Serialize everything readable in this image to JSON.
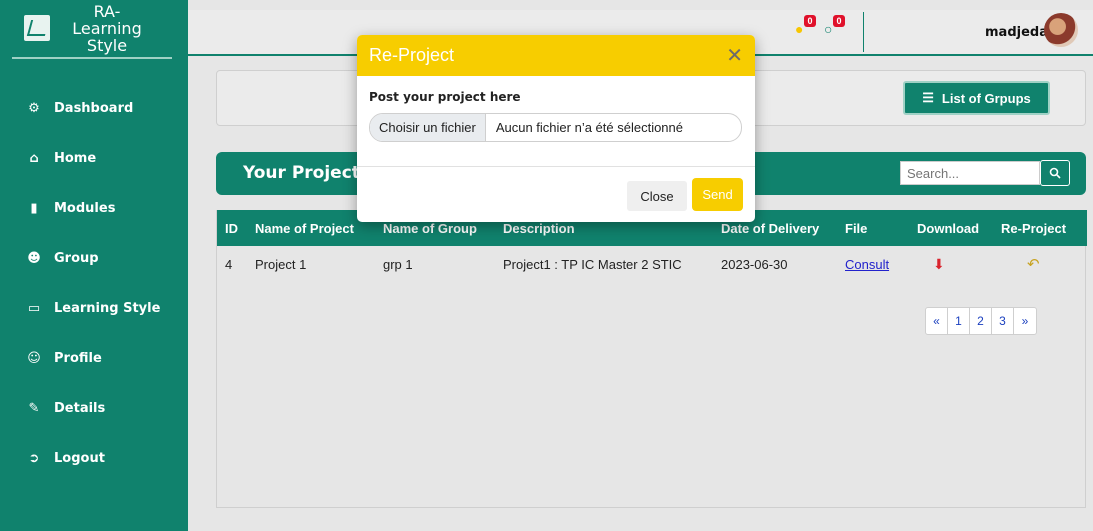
{
  "sidebar": {
    "brand": "RA-Learning Style",
    "items": [
      {
        "label": "Dashboard",
        "icon": "dashboard-icon"
      },
      {
        "label": "Home",
        "icon": "home-icon"
      },
      {
        "label": "Modules",
        "icon": "book-icon"
      },
      {
        "label": "Group",
        "icon": "users-icon"
      },
      {
        "label": "Learning Style",
        "icon": "laptop-icon"
      },
      {
        "label": "Profile",
        "icon": "user-cog-icon"
      },
      {
        "label": "Details",
        "icon": "edit-icon"
      },
      {
        "label": "Logout",
        "icon": "logout-icon"
      }
    ]
  },
  "topbar": {
    "notifications_count": "0",
    "messages_count": "0",
    "username": "madjeda"
  },
  "main": {
    "list_button": "List of Grpups",
    "projects_title": "Your Projects",
    "search_placeholder": "Search...",
    "table": {
      "headers": [
        "ID",
        "Name of Project",
        "Name of Group",
        "Description",
        "Date of Delivery",
        "File",
        "Download",
        "Re-Project"
      ],
      "rows": [
        {
          "id": "4",
          "project": "Project 1",
          "group": "grp 1",
          "description": "Project1 : TP IC Master 2 STIC",
          "date": "2023-06-30",
          "file": "Consult"
        }
      ]
    },
    "pagination": [
      "«",
      "1",
      "2",
      "3",
      "»"
    ]
  },
  "modal": {
    "title": "Re-Project",
    "label": "Post your project here",
    "choose_file": "Choisir un fichier",
    "no_file": "Aucun fichier n’a été sélectionné",
    "close_label": "Close",
    "send_label": "Send"
  },
  "colors": {
    "primary": "#10826d",
    "modal_accent": "#f7cd00",
    "download_red": "#d9232d"
  }
}
